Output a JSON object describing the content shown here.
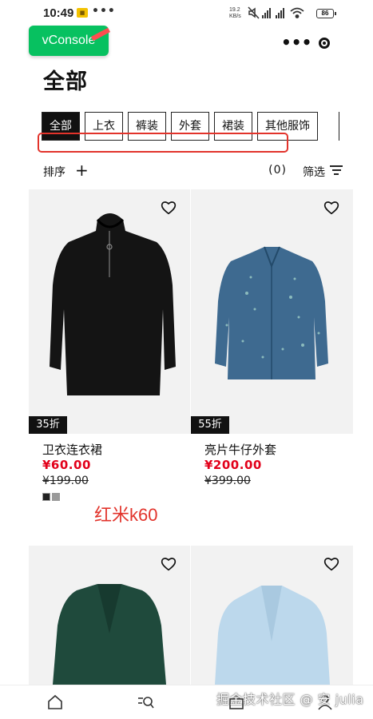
{
  "status_bar": {
    "time": "10:49",
    "notif_icon": "app-notification-icon",
    "more": "•••",
    "net_speed_value": "19.2",
    "net_speed_unit": "KB/s",
    "battery": "86"
  },
  "vconsole": {
    "label": "vConsole"
  },
  "capsule": {
    "more_icon": "more-dots-icon",
    "close_icon": "target-close-icon",
    "more_glyph": "•••"
  },
  "page": {
    "title": "全部"
  },
  "tabs": [
    {
      "label": "全部",
      "active": true
    },
    {
      "label": "上衣",
      "active": false
    },
    {
      "label": "裤装",
      "active": false
    },
    {
      "label": "外套",
      "active": false
    },
    {
      "label": "裙装",
      "active": false
    },
    {
      "label": "其他服饰",
      "active": false
    }
  ],
  "sort_bar": {
    "sort_label": "排序",
    "plus": "+",
    "filter_count": "(0)",
    "filter_label": "筛选"
  },
  "products": [
    {
      "name": "卫衣连衣裙",
      "price": "¥60.00",
      "original_price": "¥199.00",
      "discount": "35折",
      "swatches": [
        "#222222",
        "#9a9a9a"
      ]
    },
    {
      "name": "亮片牛仔外套",
      "price": "¥200.00",
      "original_price": "¥399.00",
      "discount": "55折"
    },
    {
      "name": "",
      "price": "",
      "original_price": "",
      "discount": ""
    },
    {
      "name": "",
      "price": "",
      "original_price": "",
      "discount": ""
    }
  ],
  "annotation": {
    "red_text": "红米k60"
  },
  "bottom_nav": [
    {
      "icon": "home-icon"
    },
    {
      "icon": "search-icon"
    },
    {
      "icon": "bag-icon"
    },
    {
      "icon": "profile-icon"
    }
  ],
  "watermark": {
    "text": "掘金技术社区 @ 安 julia"
  },
  "colors": {
    "accent_red": "#e2001a",
    "vconsole_green": "#07c160",
    "annotation_red": "#e2332b"
  }
}
